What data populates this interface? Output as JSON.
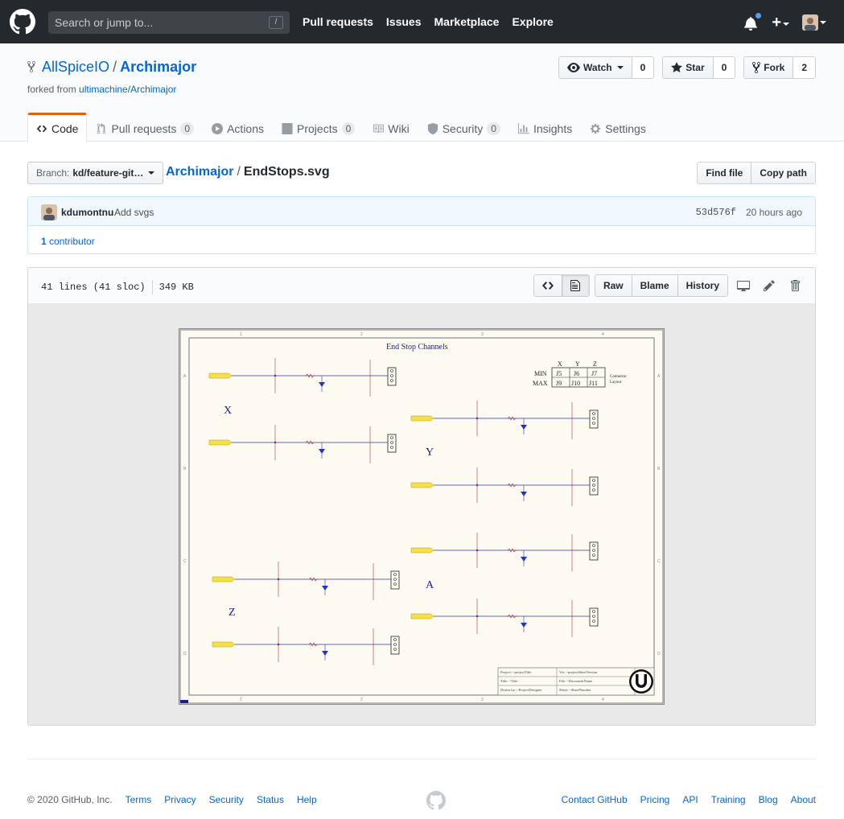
{
  "header": {
    "search_placeholder": "Search or jump to...",
    "slash_key": "/",
    "nav": [
      "Pull requests",
      "Issues",
      "Marketplace",
      "Explore"
    ],
    "plus": "+"
  },
  "repo": {
    "owner": "AllSpiceIO",
    "separator": "/",
    "name": "Archimajor",
    "forked_prefix": "forked from",
    "forked_from": "ultimachine/Archimajor",
    "watch_label": "Watch",
    "watch_count": "0",
    "star_label": "Star",
    "star_count": "0",
    "fork_label": "Fork",
    "fork_count": "2"
  },
  "tabs": [
    {
      "label": "Code",
      "icon": "code-icon"
    },
    {
      "label": "Pull requests",
      "icon": "pull-request-icon",
      "count": "0"
    },
    {
      "label": "Actions",
      "icon": "play-icon"
    },
    {
      "label": "Projects",
      "icon": "project-icon",
      "count": "0"
    },
    {
      "label": "Wiki",
      "icon": "book-icon"
    },
    {
      "label": "Security",
      "icon": "shield-icon",
      "count": "0"
    },
    {
      "label": "Insights",
      "icon": "graph-icon"
    },
    {
      "label": "Settings",
      "icon": "gear-icon"
    }
  ],
  "file_nav": {
    "branch_label": "Branch:",
    "branch_value": "kd/feature-git…",
    "breadcrumb_root": "Archimajor",
    "breadcrumb_sep": "/",
    "file_name": "EndStops.svg",
    "find_file": "Find file",
    "copy_path": "Copy path"
  },
  "commit": {
    "author": "kdumontnu",
    "message": "Add svgs",
    "sha": "53d576f",
    "time": "20 hours ago",
    "contributors_count": "1",
    "contributors_label": "contributor"
  },
  "file": {
    "lines": "41 lines (41 sloc)",
    "size": "349 KB",
    "raw": "Raw",
    "blame": "Blame",
    "history": "History"
  },
  "schematic": {
    "title": "End Stop Channels",
    "axis_labels": [
      "X",
      "Y",
      "Z",
      "A"
    ],
    "connector_table": {
      "cols": [
        "X",
        "Y",
        "Z"
      ],
      "rows": [
        {
          "label": "MIN",
          "values": [
            "J5",
            "J6",
            "J7"
          ]
        },
        {
          "label": "MAX",
          "values": [
            "J9",
            "J10",
            "J11"
          ]
        }
      ],
      "caption_1": "Connector",
      "caption_2": "Layout"
    },
    "border_cols": [
      "1",
      "2",
      "3",
      "4"
    ],
    "border_rows": [
      "A",
      "B",
      "C",
      "D"
    ],
    "title_block": {
      "project": "Project: ~projectTitle",
      "ver": "Ver: ~projectSheetVersion",
      "title": "Title: ~Title",
      "file": "File: ~DocumentName",
      "drawn": "Drawn by: ~ProjectDesigner",
      "sheet": "Sheet: ~SheetNumber"
    }
  },
  "footer": {
    "copyright": "© 2020 GitHub, Inc.",
    "left_links": [
      "Terms",
      "Privacy",
      "Security",
      "Status",
      "Help"
    ],
    "right_links": [
      "Contact GitHub",
      "Pricing",
      "API",
      "Training",
      "Blog",
      "About"
    ]
  },
  "colors": {
    "header_bg": "#24292e",
    "link": "#0366d6",
    "tab_accent": "#e36209",
    "schematic_wire": "#3333aa",
    "schematic_net": "#f5e04a",
    "schematic_text": "#1a1a9a"
  }
}
